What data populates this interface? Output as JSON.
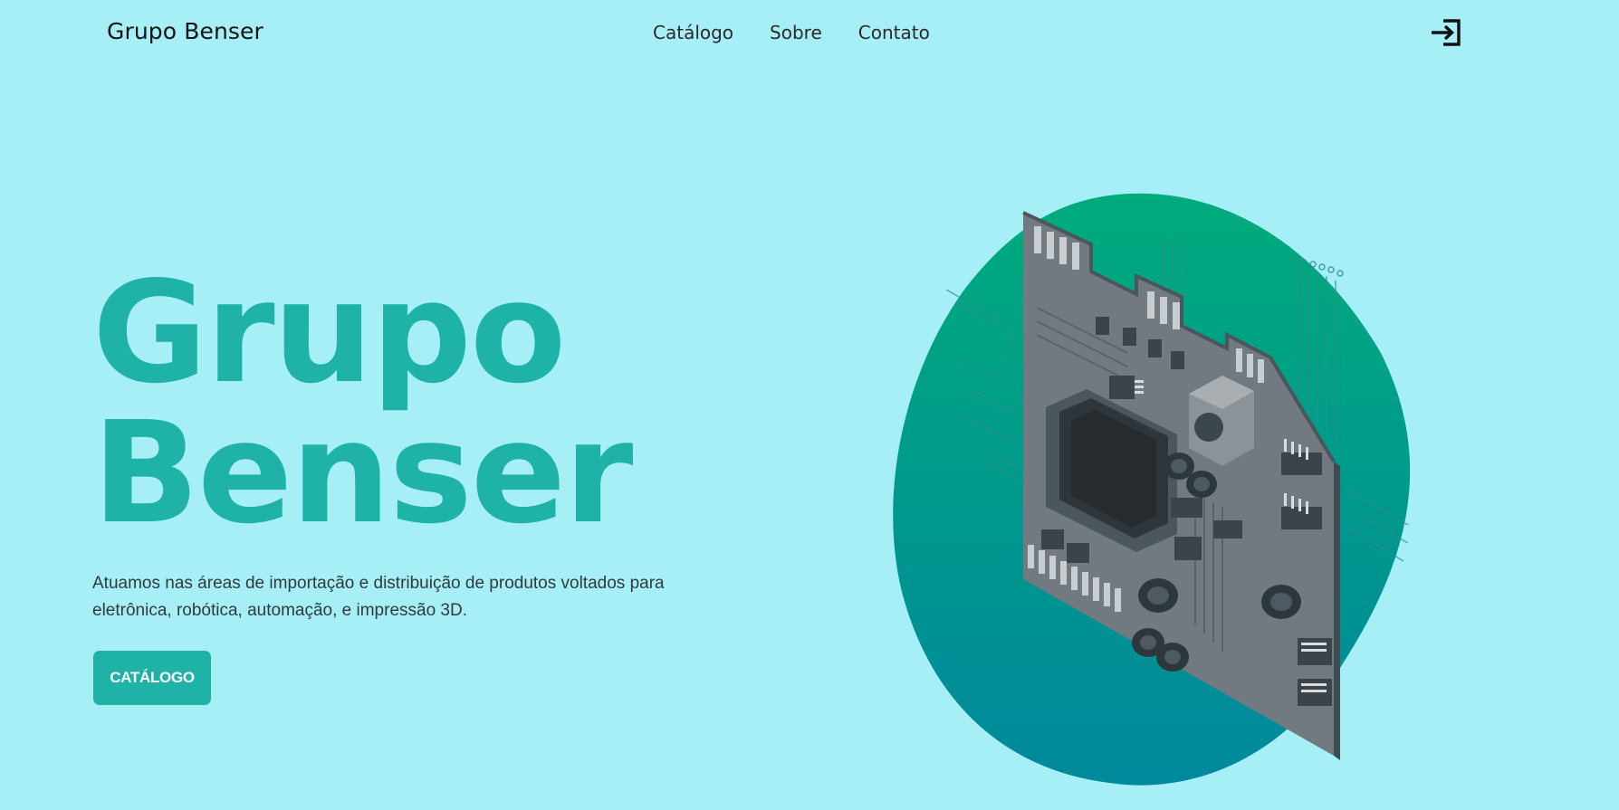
{
  "header": {
    "brand": "Grupo Benser",
    "nav": [
      {
        "label": "Catálogo"
      },
      {
        "label": "Sobre"
      },
      {
        "label": "Contato"
      }
    ],
    "login_icon": "login-icon"
  },
  "hero": {
    "title_line1": "Grupo",
    "title_line2": "Benser",
    "description": "Atuamos nas áreas de importação e distribuição de produtos voltados para eletrônica, robótica, automação, e impressão 3D.",
    "cta_label": "CATÁLOGO",
    "illustration": "circuit-board-illustration"
  },
  "colors": {
    "background": "#a6eff7",
    "accent": "#1fb2a6",
    "blob_top": "#00ab7c",
    "blob_bottom": "#00889c"
  }
}
